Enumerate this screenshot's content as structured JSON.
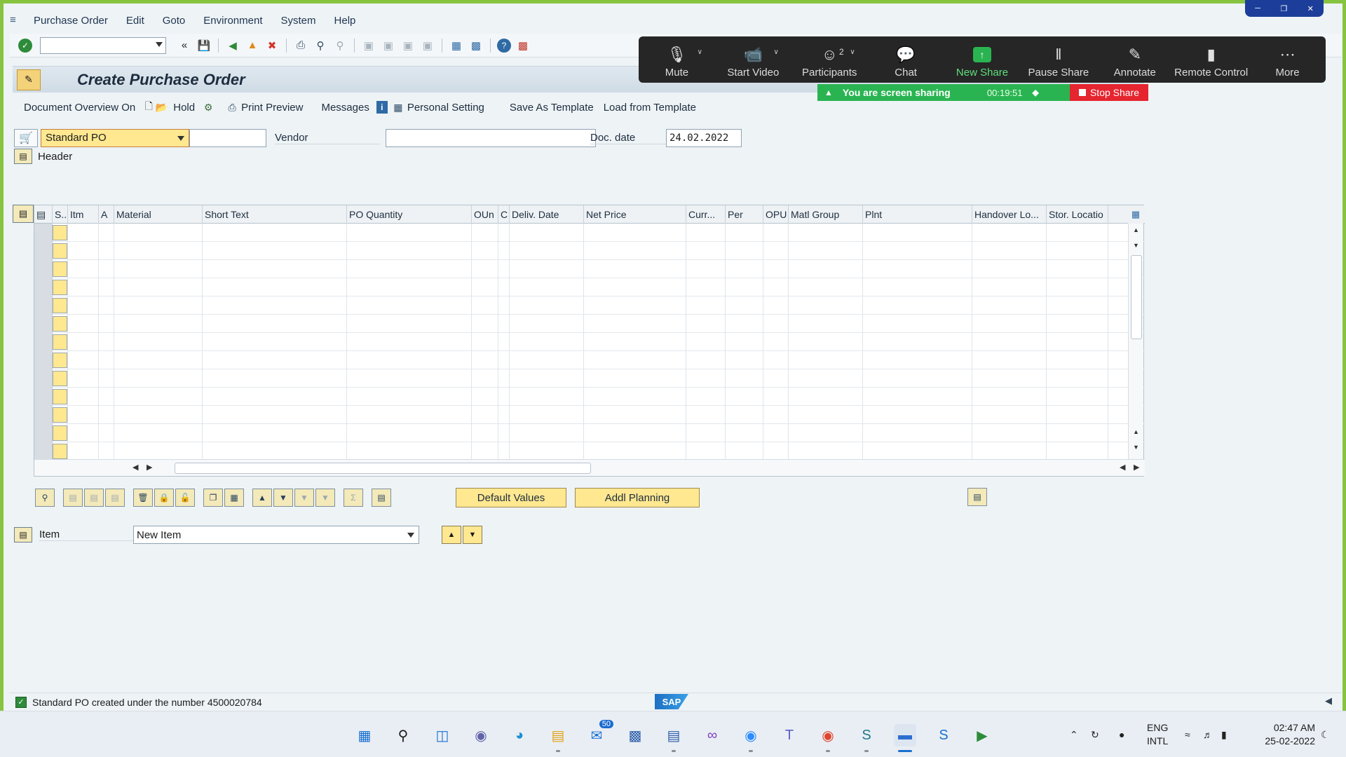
{
  "menu": {
    "items": [
      "Purchase Order",
      "Edit",
      "Goto",
      "Environment",
      "System",
      "Help"
    ]
  },
  "title": "Create Purchase Order",
  "app_toolbar": {
    "document_overview": "Document Overview On",
    "hold": "Hold",
    "print_preview": "Print Preview",
    "messages": "Messages",
    "personal_setting": "Personal Setting",
    "save_as_template": "Save As Template",
    "load_from_template": "Load from Template"
  },
  "header_line": {
    "doc_type": "Standard PO",
    "vendor_label": "Vendor",
    "vendor_value": "",
    "doc_date_label": "Doc. date",
    "doc_date_value": "24.02.2022",
    "header_label": "Header"
  },
  "grid": {
    "columns": [
      "S..",
      "Itm",
      "A",
      "Material",
      "Short Text",
      "PO Quantity",
      "OUn",
      "C",
      "Deliv. Date",
      "Net Price",
      "Curr...",
      "Per",
      "OPU",
      "Matl Group",
      "Plnt",
      "Handover Lo...",
      "Stor. Locatio"
    ],
    "row_count": 13
  },
  "grid_buttons": {
    "default_values": "Default Values",
    "addl_planning": "Addl Planning"
  },
  "item_line": {
    "label": "Item",
    "value": "New Item"
  },
  "status": {
    "message": "Standard PO created under the number 4500020784",
    "type": "success"
  },
  "sap_logo": "SAP",
  "zoom": {
    "buttons": [
      {
        "label": "Mute",
        "icon": "microphone-icon"
      },
      {
        "label": "Start Video",
        "icon": "video-off-icon"
      },
      {
        "label": "Participants",
        "icon": "participants-icon",
        "count": "2"
      },
      {
        "label": "Chat",
        "icon": "chat-icon"
      },
      {
        "label": "New Share",
        "icon": "share-icon"
      },
      {
        "label": "Pause Share",
        "icon": "pause-icon"
      },
      {
        "label": "Annotate",
        "icon": "pen-icon"
      },
      {
        "label": "Remote Control",
        "icon": "mouse-icon"
      },
      {
        "label": "More",
        "icon": "more-icon"
      }
    ],
    "sharing_text": "You are screen sharing",
    "timer": "00:19:51",
    "stop_share": "Stop Share"
  },
  "taskbar": {
    "notification_count": "50",
    "lang_top": "ENG",
    "lang_bottom": "INTL",
    "time": "02:47 AM",
    "date": "25-02-2022"
  },
  "colors": {
    "accent_yellow": "#ffe890",
    "share_green": "#2ab451",
    "stop_red": "#e5252f",
    "frame_green": "#86c440"
  }
}
